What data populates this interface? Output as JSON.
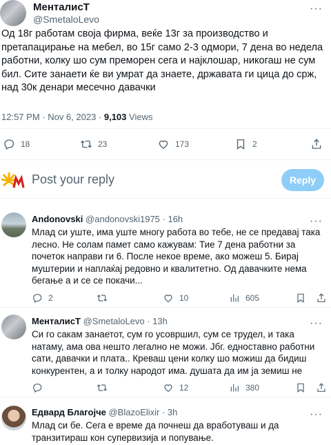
{
  "main": {
    "author_name": "МенталисТ",
    "author_handle": "@SmetaloLevo",
    "text": "Од 18г работам своја фирма, веќе 13г за производство и претапацирање на мебел, во 15г само 2-3 одмори, 7 дена во недела работни, колку шо сум преморен сега и најклошар, никогаш не сум бил. Сите занаети ќе ви умрат да знаете, државата ги цица до срж, над 30к денари месечно давачки",
    "time": "12:57 PM · Nov 6, 2023 · ",
    "views_count": "9,103",
    "views_label": "Views",
    "stats": {
      "replies": "18",
      "reposts": "23",
      "likes": "173",
      "bookmarks": "2"
    }
  },
  "reply_box": {
    "placeholder": "Post your reply",
    "button_label": "Reply"
  },
  "replies": [
    {
      "name": "Andonovski",
      "handle": "@andonovski1975 · 16h",
      "text": "Млад си уште, има уште многу работа во тебе, не се предавај така лесно. Не солам памет само кажувам: Тие 7 дена работни за почеток направи ги 6. После некое време,  ако можеш 5. Бирај муштерии и наплаќај редовно и квалитетно. Од давачките нема бегање а и се се покачи...",
      "replies": "2",
      "likes": "10",
      "views": "605"
    },
    {
      "name": "МенталисТ",
      "handle": "@SmetaloLevo · 13h",
      "text": "Си го сакам занаетот, сум го усовршил, сум се трудел, и така натаму, ама ова нешто легално не можи. Јбг. едноставно работни сати, давачки и плата.. Креваш цени колку шо можиш да бидиш конкурентен, а и толку народот има. душата да им ја земиш не можиш. И крајно е странство. То е",
      "replies": "",
      "likes": "12",
      "views": "380"
    },
    {
      "name": "Едвард Благојче",
      "handle": "@BlazoElixir · 3h",
      "text": "Млад си бе. Сега е време да почнеш да вработуваш и да транзитираш кон супервизија и попување.",
      "replies": "",
      "likes": "",
      "views": ""
    }
  ],
  "colors": {
    "accent_disabled": "#8ecdf8",
    "secondary_text": "#536471",
    "logo_red": "#d6201f",
    "logo_yellow": "#f5b400"
  },
  "icons": [
    "more-icon",
    "reply-icon",
    "repost-icon",
    "like-icon",
    "bookmark-icon",
    "share-icon",
    "views-icon",
    "ima-logo"
  ]
}
